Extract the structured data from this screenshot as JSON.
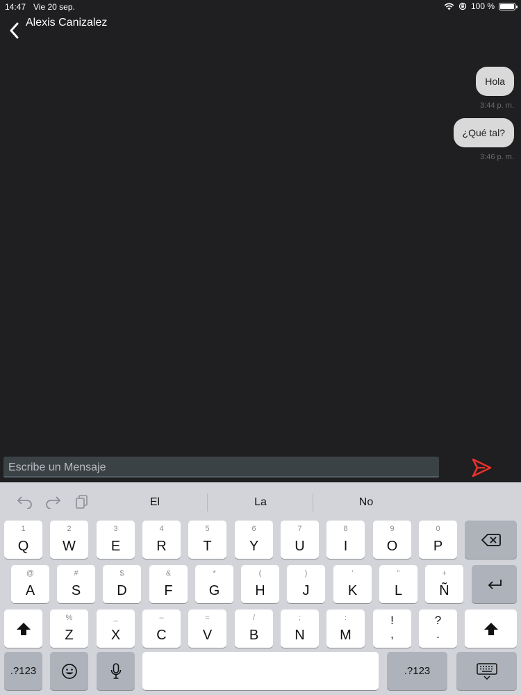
{
  "status_bar": {
    "time": "14:47",
    "date": "Vie 20 sep.",
    "battery_text": "100 %",
    "battery_level": 1.0
  },
  "header": {
    "contact_name": "Alexis Canizalez",
    "back_icon": "chevron-left-icon"
  },
  "messages": [
    {
      "text": "Hola",
      "time": "3:44 p. m."
    },
    {
      "text": "¿Qué tal?",
      "time": "3:46 p. m."
    }
  ],
  "composer": {
    "placeholder": "Escribe un Mensaje",
    "send_icon": "send-icon",
    "send_color": "#e8322b"
  },
  "keyboard": {
    "tools": [
      "undo-icon",
      "redo-icon",
      "paste-icon"
    ],
    "suggestions": [
      "El",
      "La",
      "No"
    ],
    "row1": [
      {
        "main": "Q",
        "sub": "1"
      },
      {
        "main": "W",
        "sub": "2"
      },
      {
        "main": "E",
        "sub": "3"
      },
      {
        "main": "R",
        "sub": "4"
      },
      {
        "main": "T",
        "sub": "5"
      },
      {
        "main": "Y",
        "sub": "6"
      },
      {
        "main": "U",
        "sub": "7"
      },
      {
        "main": "I",
        "sub": "8"
      },
      {
        "main": "O",
        "sub": "9"
      },
      {
        "main": "P",
        "sub": "0"
      }
    ],
    "row2": [
      {
        "main": "A",
        "sub": "@"
      },
      {
        "main": "S",
        "sub": "#"
      },
      {
        "main": "D",
        "sub": "$"
      },
      {
        "main": "F",
        "sub": "&"
      },
      {
        "main": "G",
        "sub": "*"
      },
      {
        "main": "H",
        "sub": "("
      },
      {
        "main": "J",
        "sub": ")"
      },
      {
        "main": "K",
        "sub": "’"
      },
      {
        "main": "L",
        "sub": "”"
      },
      {
        "main": "Ñ",
        "sub": "+"
      }
    ],
    "row3": [
      {
        "main": "Z",
        "sub": "%"
      },
      {
        "main": "X",
        "sub": "_"
      },
      {
        "main": "C",
        "sub": "–"
      },
      {
        "main": "V",
        "sub": "="
      },
      {
        "main": "B",
        "sub": "/"
      },
      {
        "main": "N",
        "sub": ";"
      },
      {
        "main": "M",
        "sub": ":"
      }
    ],
    "punct": [
      {
        "top": "!",
        "bottom": ","
      },
      {
        "top": "?",
        "bottom": "."
      }
    ],
    "numbers_label": ".?123",
    "icons": {
      "backspace": "backspace-icon",
      "return": "return-icon",
      "shift": "shift-icon",
      "emoji": "emoji-icon",
      "mic": "microphone-icon",
      "hide": "keyboard-hide-icon"
    }
  }
}
